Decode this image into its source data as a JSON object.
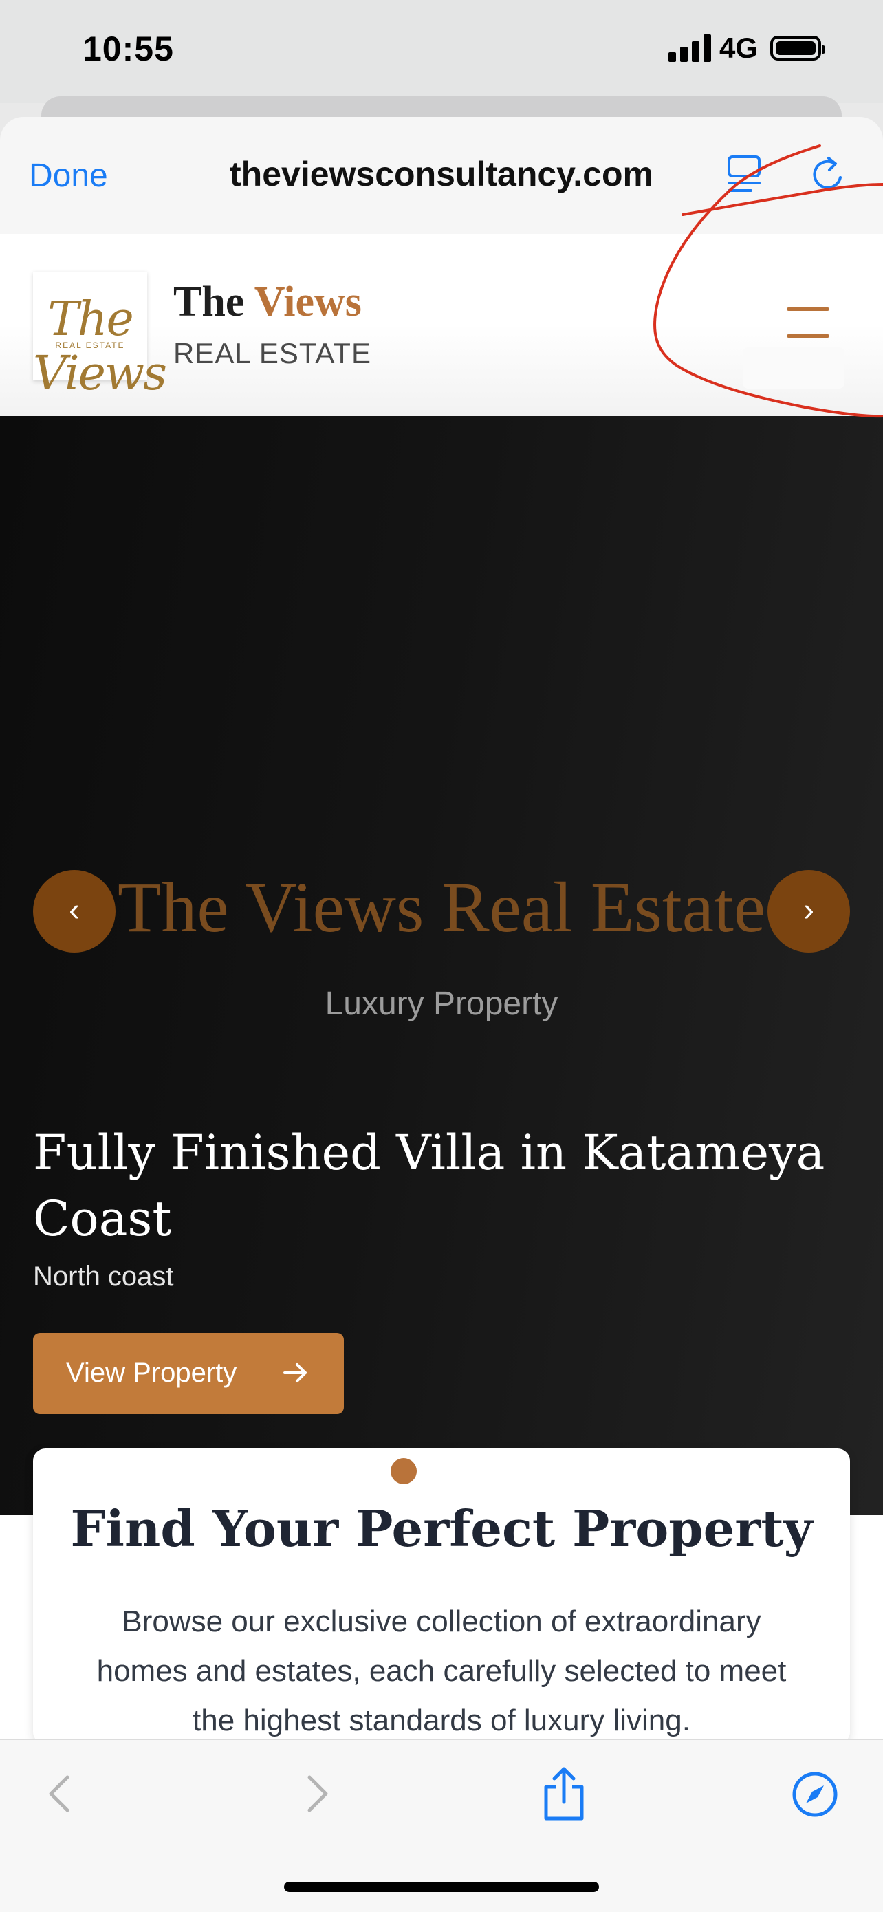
{
  "status_bar": {
    "time": "10:55",
    "network": "4G"
  },
  "safari": {
    "done_label": "Done",
    "url": "theviewsconsultancy.com",
    "icons": {
      "reader": "reader-mode-icon",
      "reload": "reload-icon"
    }
  },
  "site_header": {
    "logo_text": "The Views",
    "logo_subtext": "REAL ESTATE",
    "brand_word1": "The",
    "brand_word2": "Views",
    "brand_subtitle": "REAL ESTATE",
    "menu_icon": "hamburger-menu-icon",
    "accent_color": "#b9733a"
  },
  "hero": {
    "title": "The Views Real Estate",
    "subtitle": "Luxury Property",
    "prev_glyph": "‹",
    "next_glyph": "›",
    "slide_title": "Fully Finished Villa in Katameya Coast",
    "slide_location": "North coast",
    "cta_label": "View Property",
    "cta_color": "#c27b3a"
  },
  "card": {
    "title": "Find Your Perfect Property",
    "body": "Browse our exclusive collection of extraordinary homes and estates, each carefully selected to meet the highest standards of luxury living."
  },
  "toolbar": {
    "icons": [
      "back-icon",
      "forward-icon",
      "share-icon",
      "compass-icon"
    ]
  },
  "annotation": {
    "color": "#d9301e"
  }
}
